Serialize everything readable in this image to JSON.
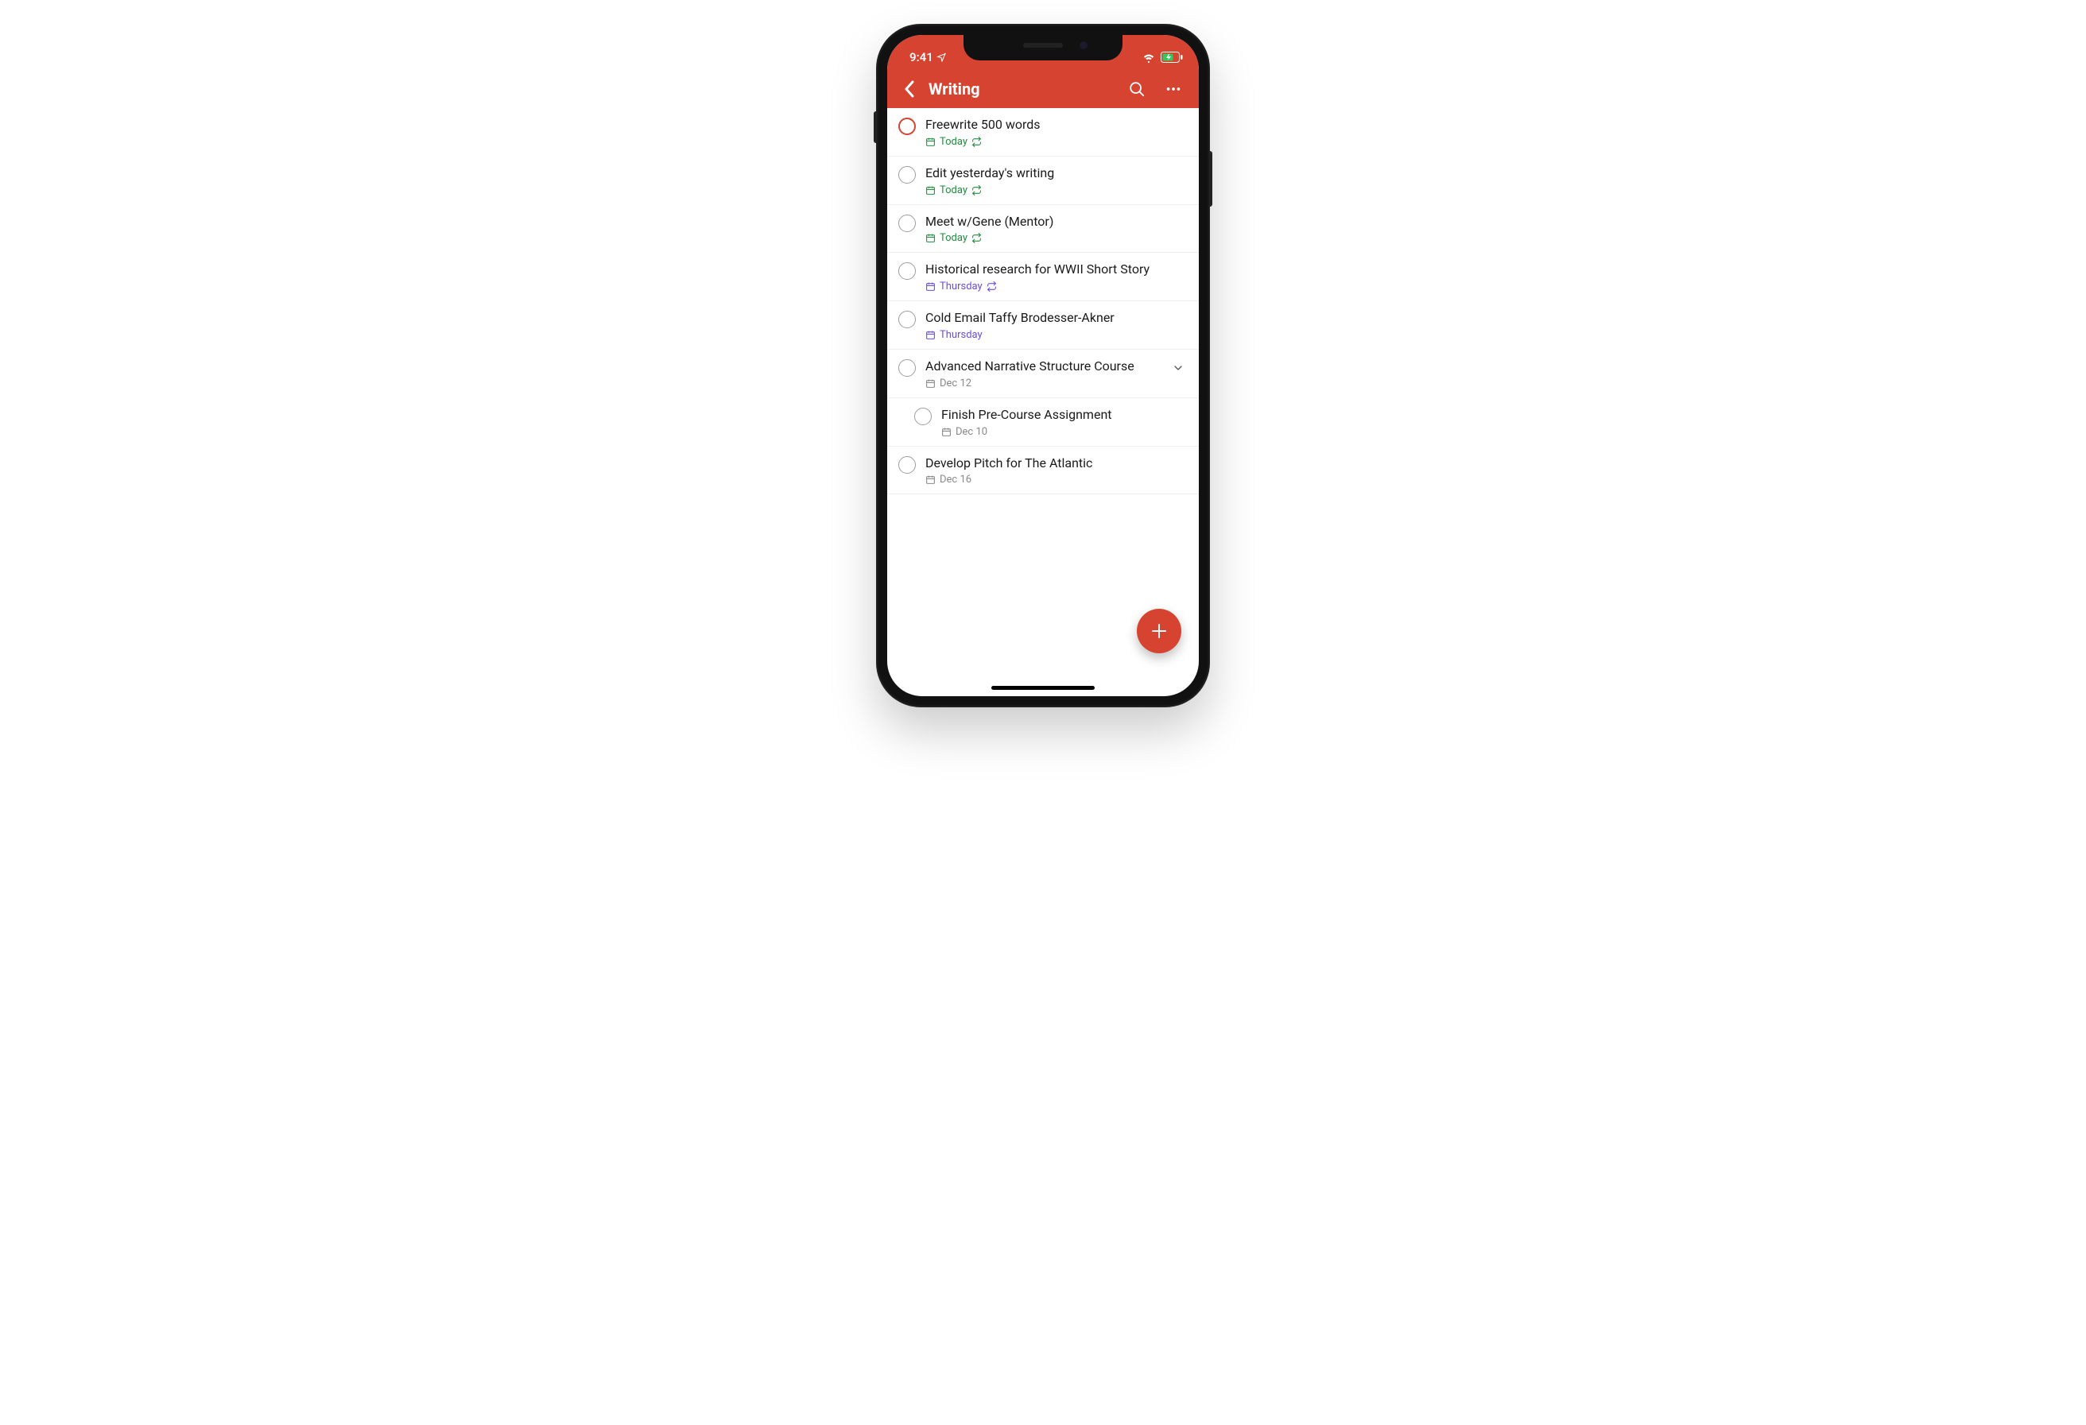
{
  "status_bar": {
    "time": "9:41"
  },
  "header": {
    "title": "Writing"
  },
  "tasks": [
    {
      "title": "Freewrite 500 words",
      "date": "Today",
      "meta_style": "green",
      "recurring": true,
      "priority": true
    },
    {
      "title": "Edit yesterday's writing",
      "date": "Today",
      "meta_style": "green",
      "recurring": true
    },
    {
      "title": "Meet w/Gene (Mentor)",
      "date": "Today",
      "meta_style": "green",
      "recurring": true
    },
    {
      "title": "Historical research for WWII Short Story",
      "date": "Thursday",
      "meta_style": "purple",
      "recurring": true
    },
    {
      "title": "Cold Email Taffy Brodesser-Akner",
      "date": "Thursday",
      "meta_style": "purple"
    },
    {
      "title": "Advanced Narrative Structure Course",
      "date": "Dec 12",
      "meta_style": "gray",
      "expandable": true
    },
    {
      "title": "Finish Pre-Course Assignment",
      "date": "Dec 10",
      "meta_style": "gray",
      "subtask": true
    },
    {
      "title": "Develop Pitch for The Atlantic",
      "date": "Dec 16",
      "meta_style": "gray"
    }
  ]
}
